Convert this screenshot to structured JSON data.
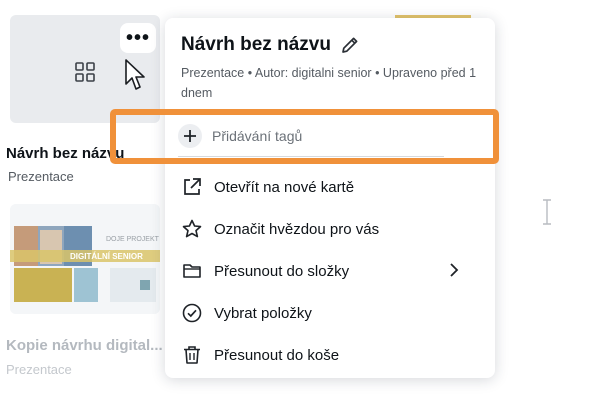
{
  "background_cards": [
    {
      "title": "Návrh bez názvu",
      "subtitle": "Prezentace"
    },
    {
      "title": "Kopie návrhu digital...",
      "subtitle": "Prezentace",
      "thumbnail_text_1": "DOJE PROJEKT",
      "thumbnail_text_2": "DIGITÁLNÍ SENIOR"
    }
  ],
  "menu": {
    "title": "Návrh bez názvu",
    "meta": "Prezentace • Autor: digitalni senior • Upraveno před 1 dnem",
    "tag_placeholder": "Přidávání tagů",
    "items": [
      {
        "label": "Otevřít na nové kartě",
        "icon": "external-link-icon"
      },
      {
        "label": "Označit hvězdou pro vás",
        "icon": "star-icon"
      },
      {
        "label": "Přesunout do složky",
        "icon": "folder-icon"
      },
      {
        "label": "Vybrat položky",
        "icon": "check-circle-icon"
      },
      {
        "label": "Přesunout do koše",
        "icon": "trash-icon"
      }
    ]
  },
  "colors": {
    "highlight": "#f0913a",
    "text": "#0e1318",
    "muted": "#555b62"
  }
}
